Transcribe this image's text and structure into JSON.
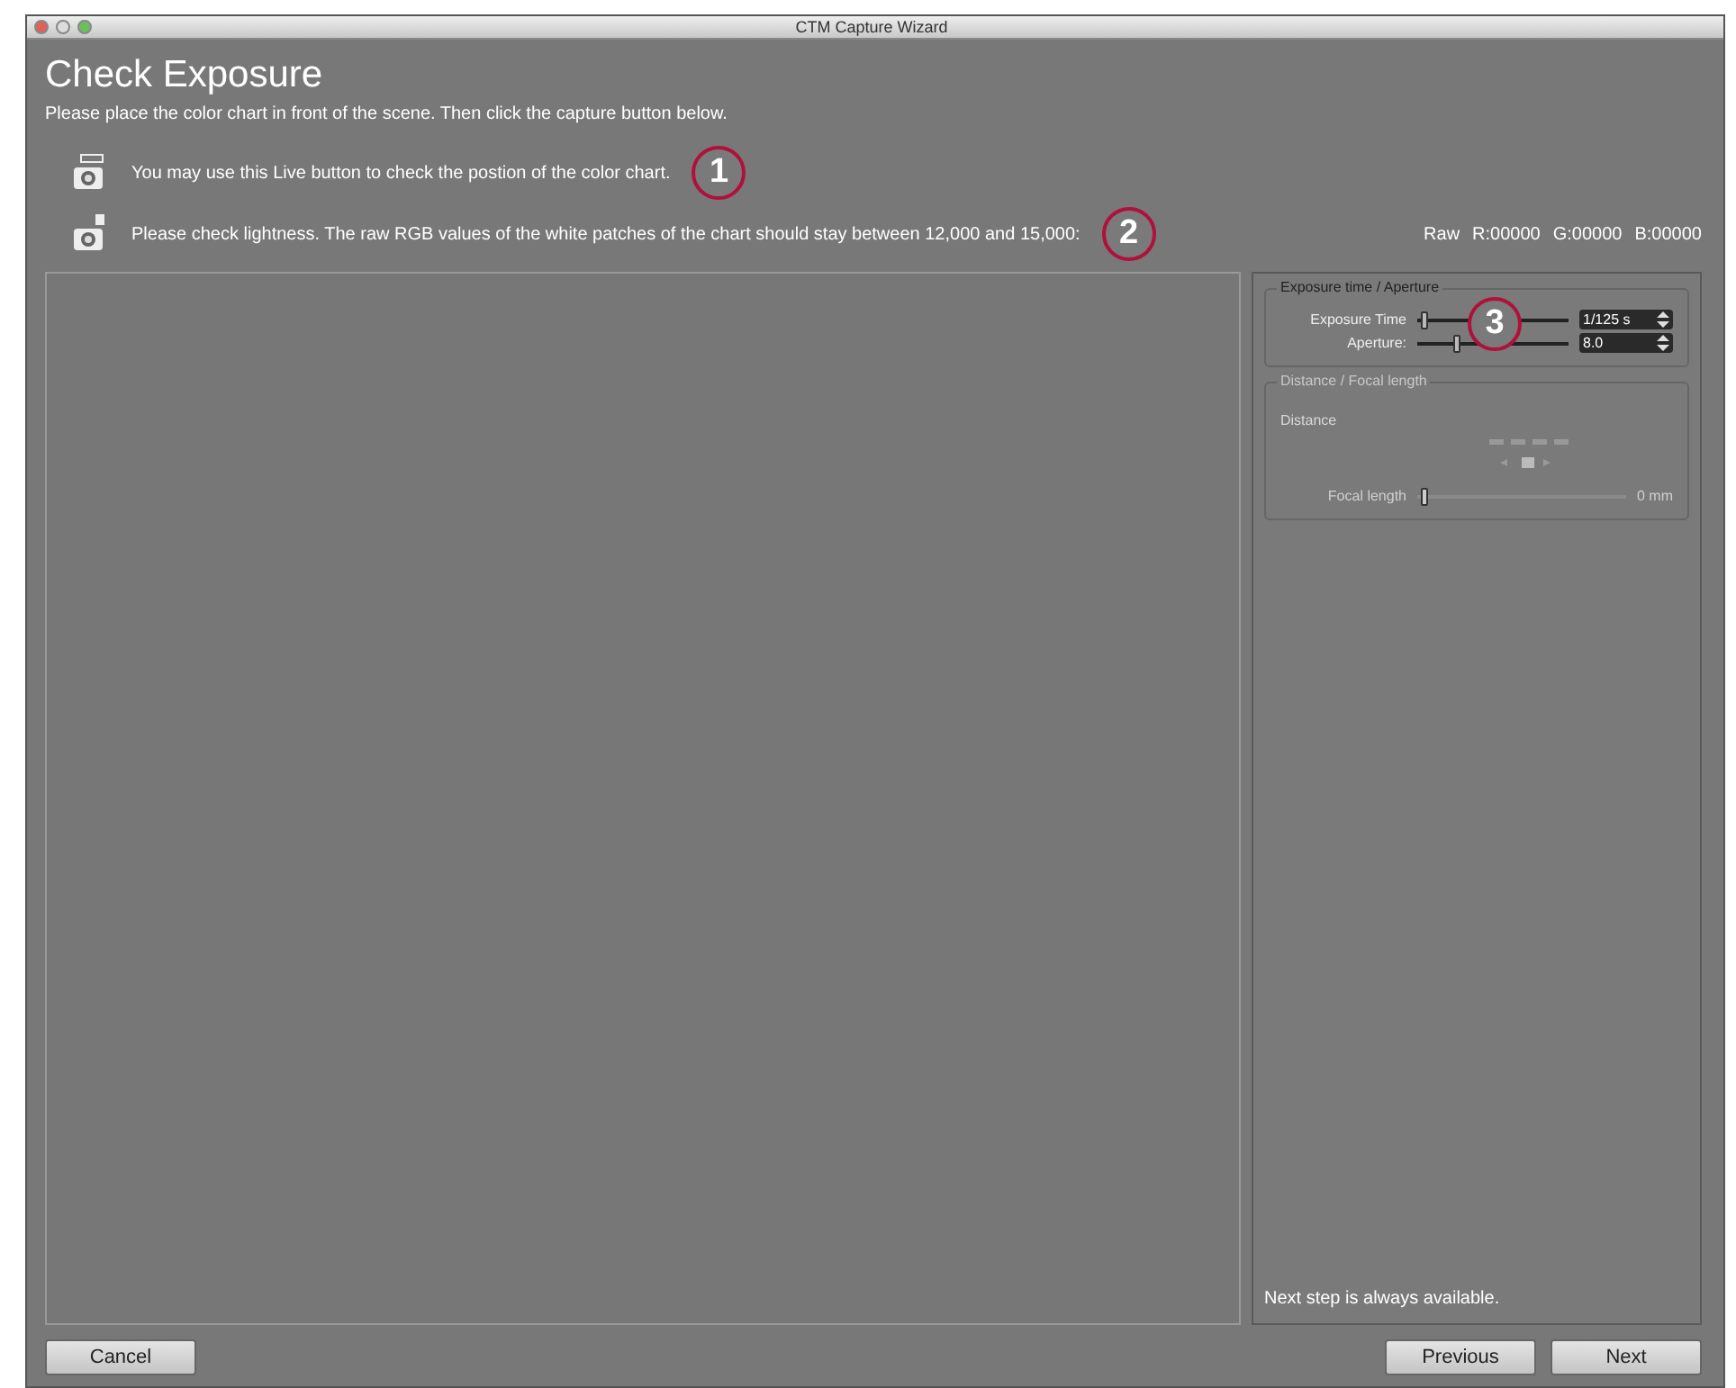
{
  "window": {
    "title": "CTM Capture Wizard"
  },
  "heading": "Check Exposure",
  "intro": "Please place the color chart in front of the scene. Then click the capture button below.",
  "hints": [
    {
      "kind": "live",
      "text": "You may use this Live button to check the postion of the color chart.",
      "callout": "1"
    },
    {
      "kind": "single",
      "text": "Please check lightness. The raw RGB values of the white patches of the chart should stay between 12,000 and 15,000:",
      "callout": "2"
    }
  ],
  "raw": {
    "label": "Raw",
    "r": "R:00000",
    "g": "G:00000",
    "b": "B:00000"
  },
  "exposure_group": {
    "title": "Exposure time / Aperture",
    "callout": "3",
    "rows": [
      {
        "label": "Exposure Time",
        "level": 0.02,
        "value": "1/125 s"
      },
      {
        "label": "Aperture:",
        "level": 0.25,
        "value": "8.0"
      }
    ]
  },
  "distance_group": {
    "title": "Distance / Focal length",
    "disabled": true,
    "distance_label": "Distance",
    "focal": {
      "label": "Focal length",
      "level": 0.02,
      "value": "0 mm"
    }
  },
  "status": "Next step is always available.",
  "buttons": {
    "cancel": "Cancel",
    "previous": "Previous",
    "next": "Next"
  }
}
